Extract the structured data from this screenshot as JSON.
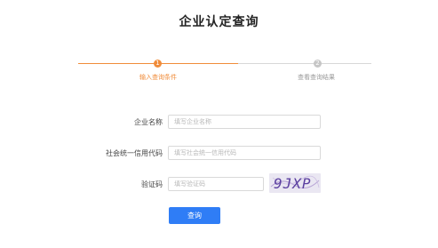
{
  "page": {
    "title": "企业认定查询"
  },
  "steps": [
    {
      "number": "1",
      "label": "输入查询条件",
      "state": "active"
    },
    {
      "number": "2",
      "label": "查看查询结果",
      "state": "pending"
    }
  ],
  "form": {
    "company_name": {
      "label": "企业名称",
      "placeholder": "填写企业名称"
    },
    "credit_code": {
      "label": "社会统一信用代码",
      "placeholder": "填写社会统一信用代码"
    },
    "captcha": {
      "label": "验证码",
      "placeholder": "填写验证码",
      "image_text": "9JXP"
    }
  },
  "actions": {
    "query_label": "查询"
  },
  "colors": {
    "accent": "#f08c3a",
    "primary_button": "#2f7df6",
    "inactive_step": "#c6c6c6"
  }
}
